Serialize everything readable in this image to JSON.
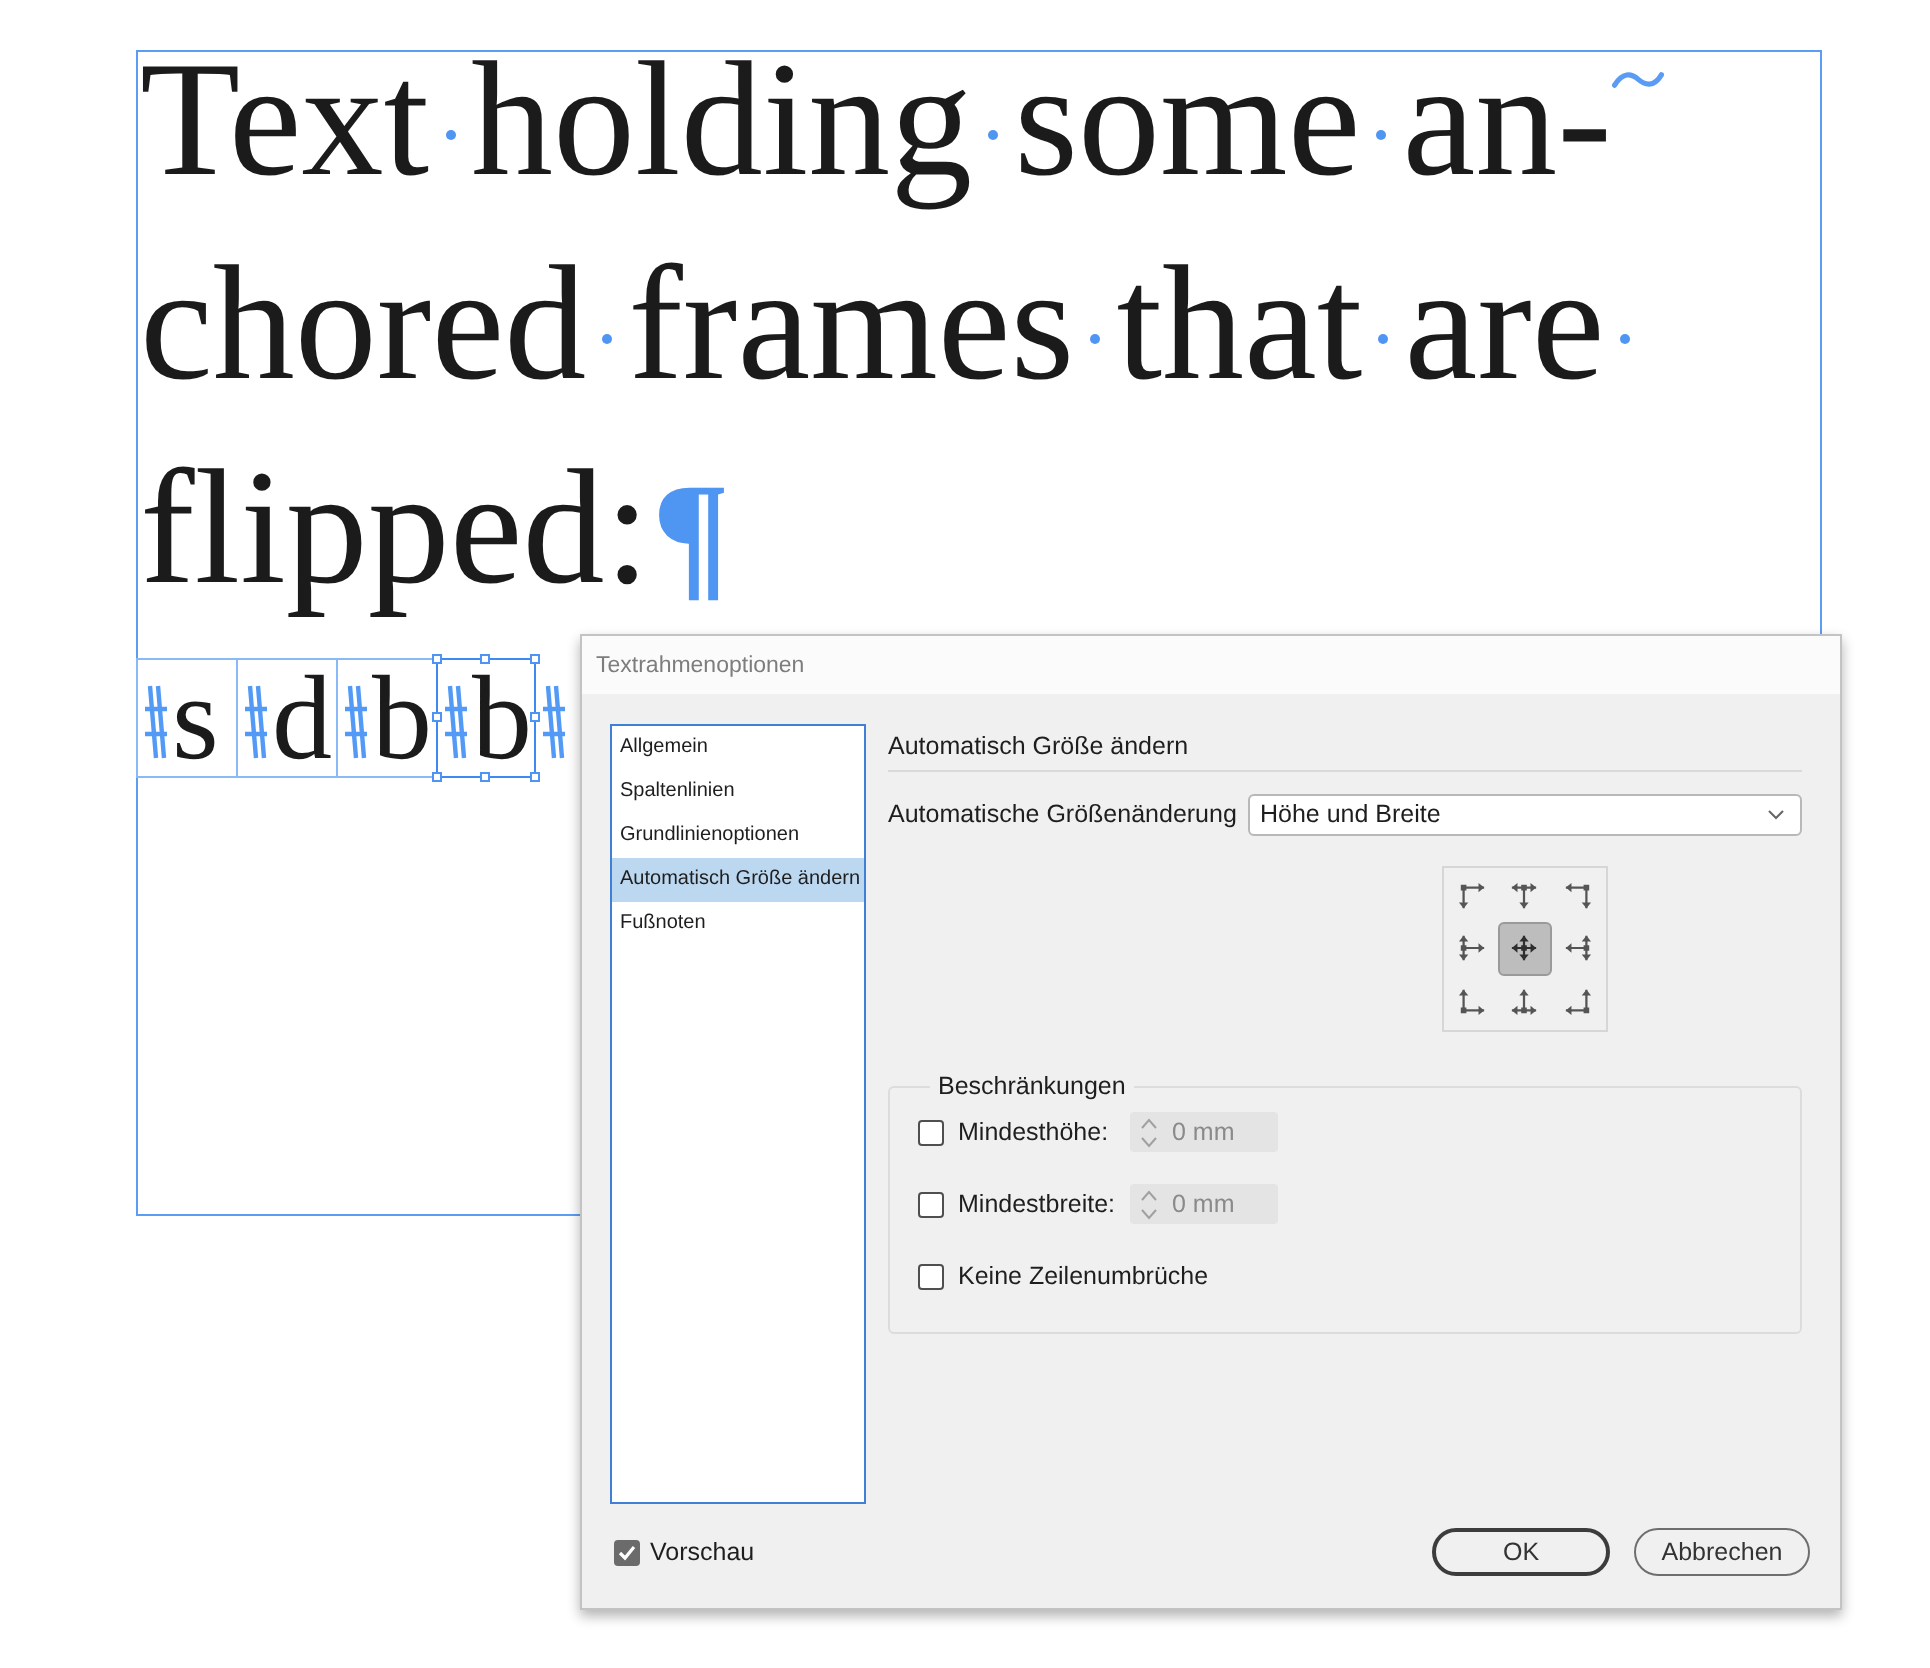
{
  "story": {
    "lines": [
      {
        "kind": "hyphenated",
        "words": [
          "Text",
          "holding",
          "some",
          "an-"
        ]
      },
      {
        "kind": "wrapped",
        "words": [
          "chored",
          "frames",
          "that",
          "are"
        ]
      },
      {
        "kind": "paragraph_end",
        "words": [
          "flipped:"
        ],
        "end_mark": "¶"
      }
    ],
    "anchored_frames": [
      {
        "letter": "s",
        "selected": false
      },
      {
        "letter": "d",
        "selected": false
      },
      {
        "letter": "b",
        "selected": false
      },
      {
        "letter": "b",
        "selected": true
      }
    ]
  },
  "dialog": {
    "title": "Textrahmenoptionen",
    "sections": [
      {
        "label": "Allgemein",
        "selected": false
      },
      {
        "label": "Spaltenlinien",
        "selected": false
      },
      {
        "label": "Grundlinienoptionen",
        "selected": false
      },
      {
        "label": "Automatisch Größe ändern",
        "selected": true
      },
      {
        "label": "Fußnoten",
        "selected": false
      }
    ],
    "panel": {
      "heading": "Automatisch Größe ändern",
      "auto_size": {
        "label": "Automatische Größenänderung",
        "value": "Höhe und Breite"
      },
      "reference_points": [
        {
          "selected": false
        },
        {
          "selected": false
        },
        {
          "selected": false
        },
        {
          "selected": false
        },
        {
          "selected": true
        },
        {
          "selected": false
        },
        {
          "selected": false
        },
        {
          "selected": false
        },
        {
          "selected": false
        }
      ],
      "constraints": {
        "title": "Beschränkungen",
        "options": [
          {
            "kind": "spinner",
            "label": "Mindesthöhe:",
            "checked": false,
            "value": "0 mm",
            "disabled": true
          },
          {
            "kind": "spinner",
            "label": "Mindestbreite:",
            "checked": false,
            "value": "0 mm",
            "disabled": true
          },
          {
            "kind": "checkbox",
            "label": "Keine Zeilenumbrüche",
            "checked": false
          }
        ]
      }
    },
    "preview": {
      "label": "Vorschau",
      "checked": true
    },
    "buttons": [
      {
        "label": "OK",
        "default": true
      },
      {
        "label": "Abbrechen",
        "default": false
      }
    ]
  }
}
